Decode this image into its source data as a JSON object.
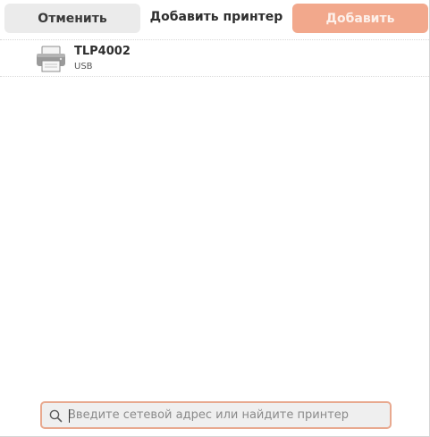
{
  "dialog": {
    "title": "Добавить принтер",
    "cancel_label": "Отменить",
    "add_label": "Добавить"
  },
  "printers": [
    {
      "name": "TLP4002",
      "connection": "USB",
      "icon": "printer-icon"
    }
  ],
  "search": {
    "value": "",
    "placeholder": "Введите сетевой адрес или найдите принтер",
    "icon": "search-icon"
  },
  "colors": {
    "accent": "#f2a88c",
    "accent_border": "#e8a98f"
  }
}
